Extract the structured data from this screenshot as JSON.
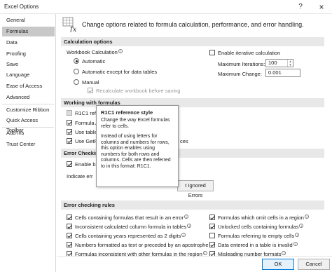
{
  "window": {
    "title": "Excel Options",
    "help": "?",
    "close": "×"
  },
  "nav": {
    "items": [
      {
        "label": "General"
      },
      {
        "label": "Formulas"
      },
      {
        "label": "Data"
      },
      {
        "label": "Proofing"
      },
      {
        "label": "Save"
      },
      {
        "label": "Language"
      },
      {
        "label": "Ease of Access"
      },
      {
        "label": "Advanced"
      },
      {
        "label": "Customize Ribbon"
      },
      {
        "label": "Quick Access Toolbar"
      },
      {
        "label": "Add-ins"
      },
      {
        "label": "Trust Center"
      }
    ],
    "active": "Formulas"
  },
  "header": {
    "text": "Change options related to formula calculation, performance, and error handling."
  },
  "calc": {
    "section": "Calculation options",
    "workbook_label": "Workbook Calculation",
    "automatic": "Automatic",
    "automatic_except": "Automatic except for data tables",
    "manual": "Manual",
    "recalc": "Recalculate workbook before saving",
    "iterative": "Enable iterative calculation",
    "max_iter_label": "Maximum Iterations:",
    "max_iter_value": "100",
    "max_change_label": "Maximum Change:",
    "max_change_value": "0.001"
  },
  "working": {
    "section": "Working with formulas",
    "r1c1": "R1C1 reference style",
    "autocomplete": "Formula AutoComplete",
    "use_table": "Use table",
    "use_getpivot": "Use GetPiv",
    "getpivot_tail": "ces"
  },
  "tooltip": {
    "title": "R1C1 reference style",
    "p1": "Change the way Excel formulas refer to cells.",
    "p2": "Instead of using letters for columns and numbers for rows, this option enables using numbers for both rows and columns. Cells are then referred to in this format: R1C1."
  },
  "errcheck": {
    "section": "Error Checking",
    "enable": "Enable b",
    "indicate": "Indicate err",
    "reset_button": "t Ignored Errors"
  },
  "rules": {
    "section": "Error checking rules",
    "left": [
      "Cells containing formulas that result in an error",
      "Inconsistent calculated column formula in tables",
      "Cells containing years represented as 2 digits",
      "Numbers formatted as text or preceded by an apostrophe",
      "Formulas inconsistent with other formulas in the region"
    ],
    "right": [
      "Formulas which omit cells in a region",
      "Unlocked cells containing formulas",
      "Formulas referring to empty cells",
      "Data entered in a table is invalid",
      "Misleading number formats"
    ]
  },
  "footer": {
    "ok": "OK",
    "cancel": "Cancel"
  }
}
